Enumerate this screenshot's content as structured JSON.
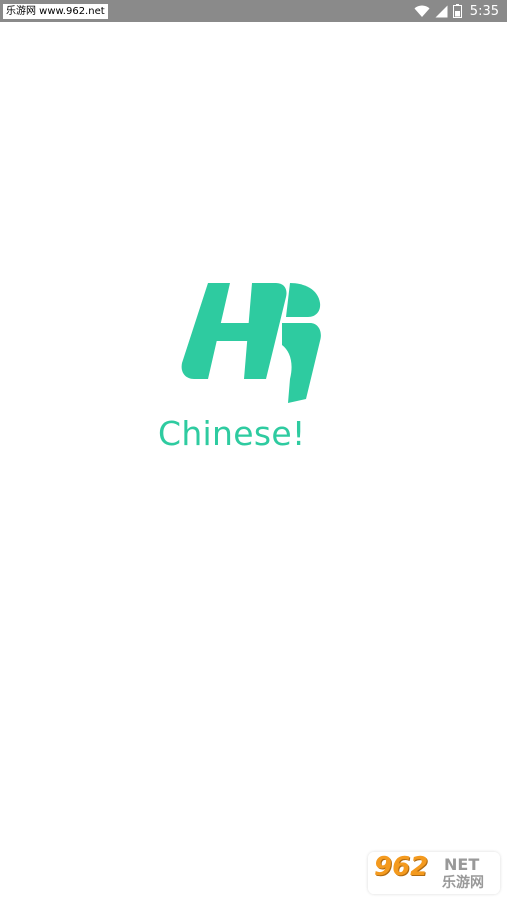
{
  "status_bar": {
    "watermark": "乐游网 www.962.net",
    "time": "5:35",
    "icons": [
      "wifi-icon",
      "signal-icon",
      "battery-icon"
    ]
  },
  "logo": {
    "mark": "Hi",
    "text": "Chinese!",
    "color": "#2ecba0"
  },
  "watermark": {
    "number": "962",
    "suffix": "NET",
    "name": "乐游网"
  },
  "colors": {
    "status_bar_bg": "#8a8a8a",
    "background": "#ffffff",
    "brand": "#2ecba0",
    "watermark_orange": "#f49a1e"
  }
}
